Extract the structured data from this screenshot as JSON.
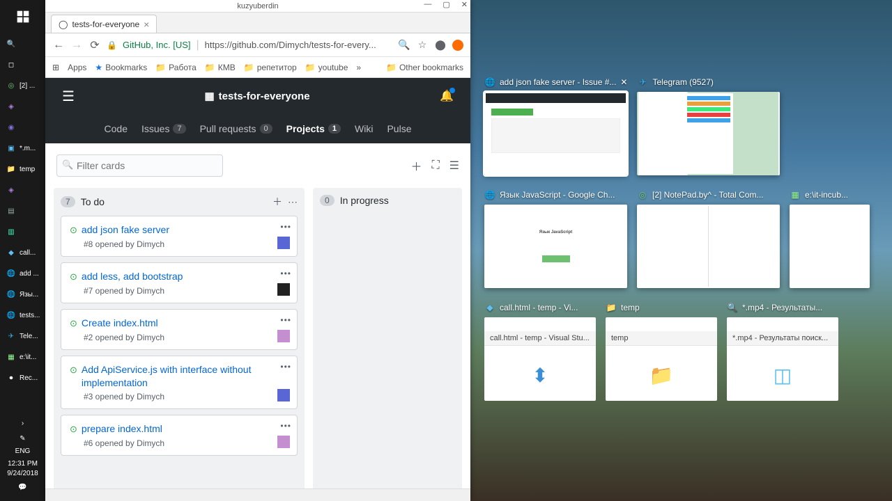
{
  "taskbar": {
    "items": [
      {
        "label": "[2] ..."
      },
      {
        "label": ""
      },
      {
        "label": ""
      },
      {
        "label": "*.m..."
      },
      {
        "label": "temp"
      },
      {
        "label": ""
      },
      {
        "label": ""
      },
      {
        "label": ""
      },
      {
        "label": "call..."
      },
      {
        "label": "add ..."
      },
      {
        "label": "Язы..."
      },
      {
        "label": "tests..."
      },
      {
        "label": "Tele..."
      },
      {
        "label": "e:\\it..."
      },
      {
        "label": "Rec..."
      }
    ],
    "lang": "ENG",
    "time": "12:31 PM",
    "date": "9/24/2018"
  },
  "browser": {
    "title": "kuzyuberdin",
    "tab": "tests-for-everyone",
    "origin": "GitHub, Inc. [US]",
    "url": "https://github.com/Dimych/tests-for-every...",
    "bookmarks": {
      "apps": "Apps",
      "bookmarks": "Bookmarks",
      "rabota": "Работа",
      "kmb": "КМВ",
      "tutor": "репетитор",
      "youtube": "youtube",
      "other": "Other bookmarks"
    }
  },
  "github": {
    "repo": "tests-for-everyone",
    "nav": {
      "code": "Code",
      "issues": "Issues",
      "issues_n": "7",
      "pulls": "Pull requests",
      "pulls_n": "0",
      "projects": "Projects",
      "projects_n": "1",
      "wiki": "Wiki",
      "pulse": "Pulse"
    },
    "filter_placeholder": "Filter cards",
    "cols": {
      "todo": {
        "count": "7",
        "title": "To do"
      },
      "progress": {
        "count": "0",
        "title": "In progress"
      }
    },
    "cards": [
      {
        "title": "add json fake server",
        "meta": "#8 opened by Dimych",
        "ava": "a"
      },
      {
        "title": "add less, add bootstrap",
        "meta": "#7 opened by Dimych",
        "ava": "b"
      },
      {
        "title": "Create index.html",
        "meta": "#2 opened by Dimych",
        "ava": "c"
      },
      {
        "title": "Add ApiService.js with interface without implementation",
        "meta": "#3 opened by Dimych",
        "ava": "a"
      },
      {
        "title": "prepare index.html",
        "meta": "#6 opened by Dimych",
        "ava": "c"
      }
    ]
  },
  "taskview": {
    "row1": [
      {
        "label": "add json fake server - Issue #...",
        "kind": "chrome",
        "sel": true
      },
      {
        "label": "Telegram (9527)",
        "kind": "telegram"
      }
    ],
    "row2": [
      {
        "label": "Язык JavaScript - Google Ch...",
        "kind": "chrome"
      },
      {
        "label": "[2] NotePad.by^ - Total Com...",
        "kind": "tc"
      },
      {
        "label": "e:\\it-incub...",
        "kind": "np"
      }
    ],
    "row3": [
      {
        "label": "call.html - temp - Vi...",
        "thumb": "call.html - temp - Visual Stu...",
        "kind": "vs"
      },
      {
        "label": "temp",
        "thumb": "temp",
        "kind": "folder"
      },
      {
        "label": "*.mp4 - Результаты...",
        "thumb": "*.mp4 - Результаты поиск...",
        "kind": "search"
      }
    ]
  }
}
